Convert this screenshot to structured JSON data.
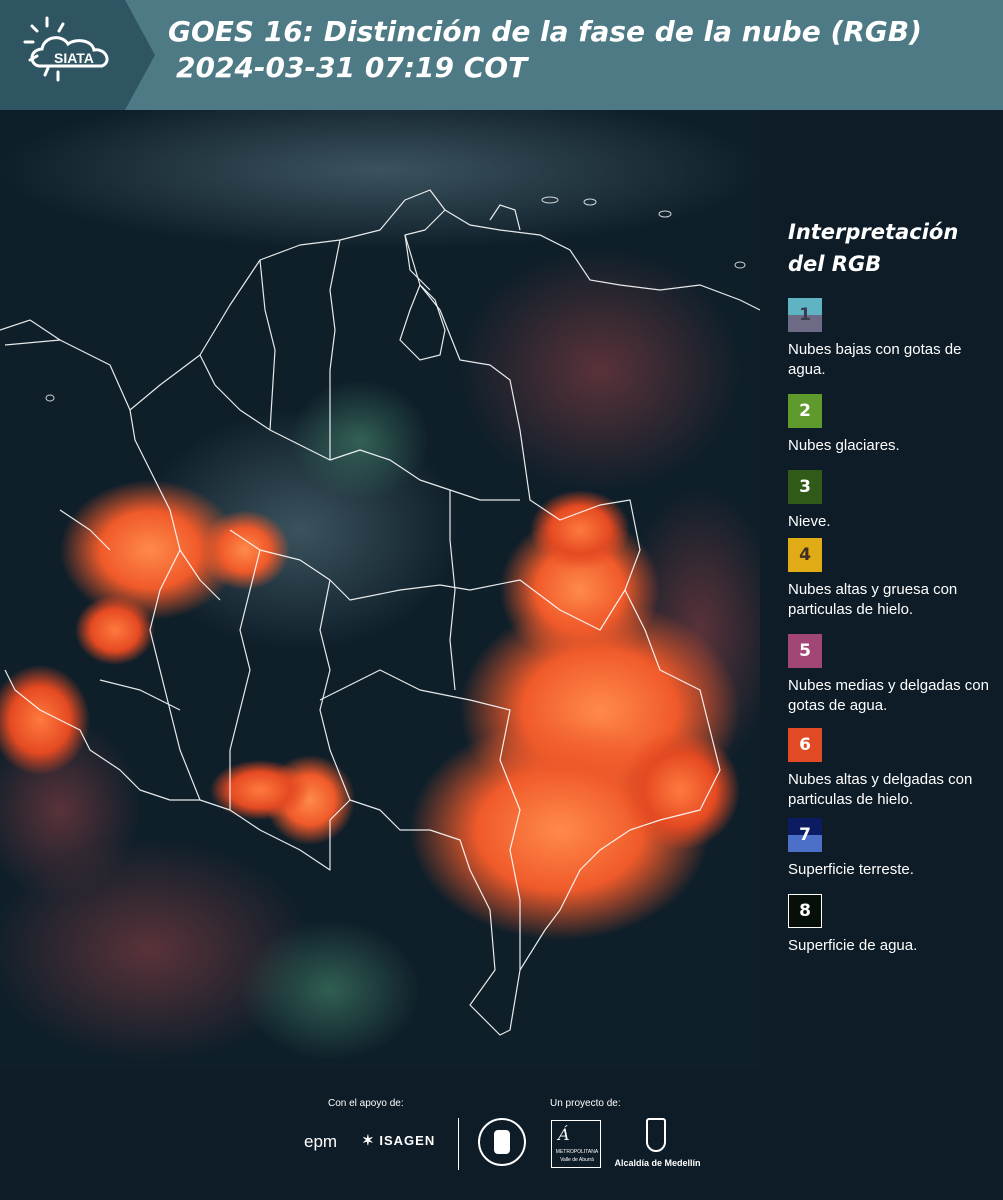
{
  "header": {
    "logo_text": "SIATA",
    "title_line1": "GOES 16: Distinción de la fase de la nube (RGB)",
    "title_line2": "2024-03-31 07:19 COT"
  },
  "legend": {
    "title": "Interpretación del RGB",
    "items": [
      {
        "number": "1",
        "label": "Nubes bajas con gotas de agua.",
        "color_top": "#5fb4c4",
        "color_bottom": "#6d6a86"
      },
      {
        "number": "2",
        "label": "Nubes glaciares.",
        "color": "#5f9a2c"
      },
      {
        "number": "3",
        "label": "Nieve.",
        "color": "#2f5a17"
      },
      {
        "number": "4",
        "label": "Nubes altas y gruesa con particulas de hielo.",
        "color": "#e1ab16"
      },
      {
        "number": "5",
        "label": "Nubes medias y delgadas con gotas de agua.",
        "color": "#a24675"
      },
      {
        "number": "6",
        "label": "Nubes altas y delgadas con particulas de hielo.",
        "color": "#e24a25"
      },
      {
        "number": "7",
        "label": "Superficie terreste.",
        "color_top": "#0c1c63",
        "color_bottom": "#4c70c8"
      },
      {
        "number": "8",
        "label": "Superficie de agua.",
        "color": "#061008"
      }
    ]
  },
  "footer": {
    "support_label": "Con el apoyo de:",
    "project_label": "Un proyecto de:",
    "sponsor_1": "epm",
    "sponsor_2": "ISAGEN",
    "partner_1": "METROPOLITANA",
    "partner_1_sub": "Valle de Aburrá",
    "partner_2": "Alcaldía de Medellín"
  },
  "colors": {
    "header_bg": "#4e7a86",
    "logo_bg": "#2f5563",
    "page_bg": "#0d1c27",
    "cloud_orange": "#f05a2a",
    "border_white": "#ffffff"
  }
}
